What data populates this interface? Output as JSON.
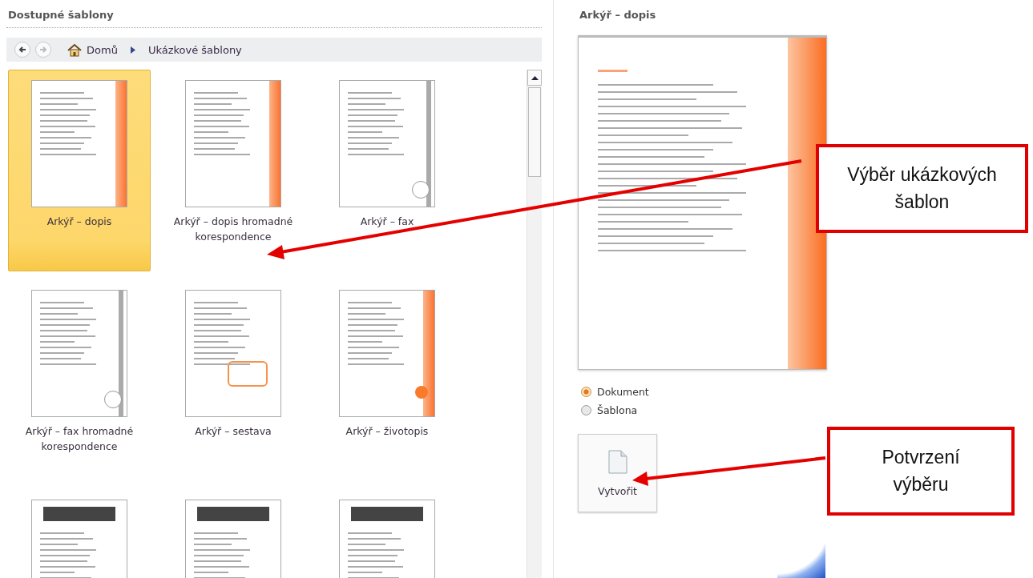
{
  "panel_title": "Dostupné šablony",
  "breadcrumb": {
    "items": [
      "Domů",
      "Ukázkové šablony"
    ]
  },
  "templates": [
    {
      "label": "Arkýř – dopis",
      "kind": "letter",
      "selected": true
    },
    {
      "label": "Arkýř – dopis hromadné korespondence",
      "kind": "letter",
      "selected": false
    },
    {
      "label": "Arkýř – fax",
      "kind": "fax",
      "selected": false
    },
    {
      "label": "Arkýř – fax hromadné korespondence",
      "kind": "fax",
      "selected": false
    },
    {
      "label": "Arkýř – sestava",
      "kind": "report",
      "selected": false
    },
    {
      "label": "Arkýř – životopis",
      "kind": "resume",
      "selected": false
    },
    {
      "kind": "brochure",
      "selected": false
    },
    {
      "kind": "newsletter",
      "selected": false
    },
    {
      "kind": "newsletter",
      "selected": false
    }
  ],
  "preview": {
    "title": "Arkýř – dopis"
  },
  "create_as": [
    {
      "label": "Dokument",
      "selected": true
    },
    {
      "label": "Šablona",
      "selected": false
    }
  ],
  "create_button": "Vytvořit",
  "callouts": [
    "Výběr ukázkových šablon",
    "Potvrzení výběru"
  ]
}
